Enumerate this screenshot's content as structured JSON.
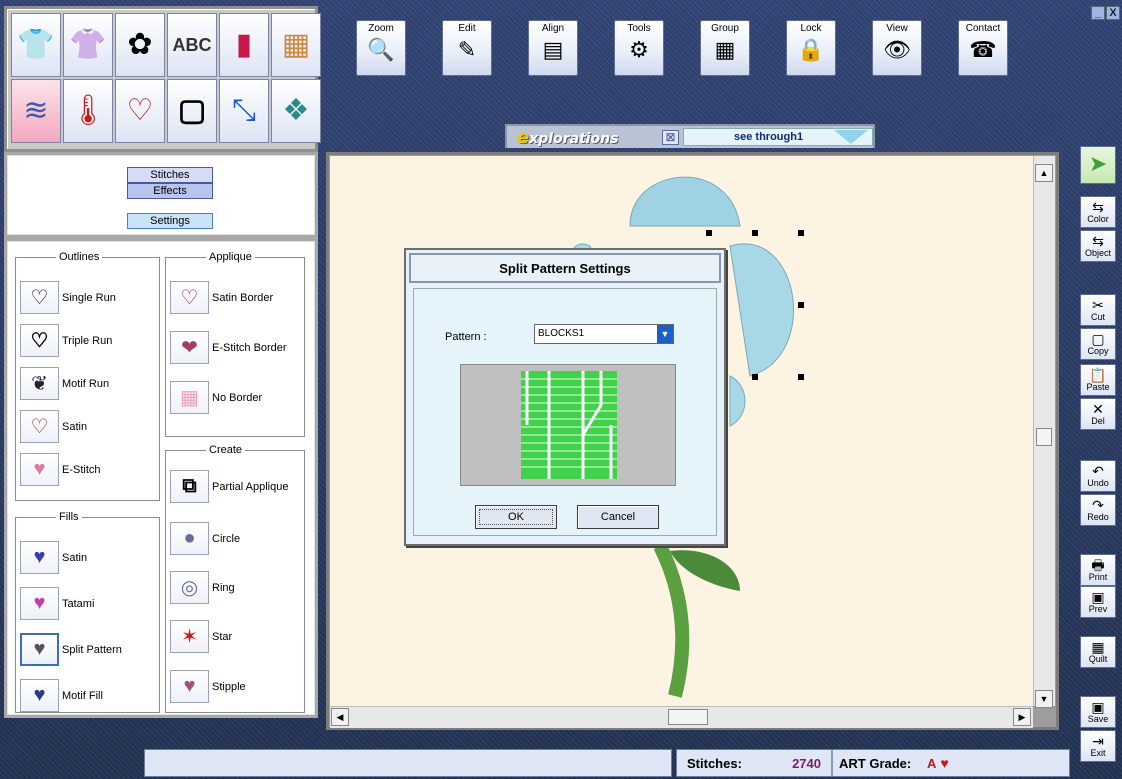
{
  "toolbar": [
    {
      "name": "zoom",
      "label": "Zoom",
      "icon": "🔍"
    },
    {
      "name": "edit",
      "label": "Edit",
      "icon": "✎"
    },
    {
      "name": "align",
      "label": "Align",
      "icon": "▤"
    },
    {
      "name": "tools",
      "label": "Tools",
      "icon": "⚙"
    },
    {
      "name": "group",
      "label": "Group",
      "icon": "▦"
    },
    {
      "name": "lock",
      "label": "Lock",
      "icon": "🔒"
    },
    {
      "name": "view",
      "label": "View",
      "icon": "👁"
    },
    {
      "name": "contact",
      "label": "Contact",
      "icon": "☎"
    }
  ],
  "window_controls": {
    "minimize": "_",
    "close": "X"
  },
  "explorations": {
    "logo_e": "e",
    "logo_rest": "xplorations",
    "close": "⊠",
    "design_name": "see through1"
  },
  "effects_panel": {
    "stitches": "Stitches",
    "effects": "Effects",
    "settings": "Settings"
  },
  "outlines": {
    "legend": "Outlines",
    "items": [
      "Single Run",
      "Triple Run",
      "Motif Run",
      "Satin",
      "E-Stitch"
    ]
  },
  "applique": {
    "legend": "Applique",
    "items": [
      "Satin Border",
      "E-Stitch Border",
      "No Border"
    ]
  },
  "fills": {
    "legend": "Fills",
    "items": [
      "Satin",
      "Tatami",
      "Split Pattern",
      "Motif Fill"
    ]
  },
  "create": {
    "legend": "Create",
    "items": [
      "Partial Applique",
      "Circle",
      "Ring",
      "Star",
      "Stipple"
    ]
  },
  "dialog": {
    "title": "Split Pattern Settings",
    "pattern_label": "Pattern :",
    "pattern_value": "BLOCKS1",
    "ok": "OK",
    "cancel": "Cancel"
  },
  "right_toolbar": [
    {
      "name": "color",
      "label": "Color",
      "icon": "⇆"
    },
    {
      "name": "object",
      "label": "Object",
      "icon": "⇆"
    },
    {
      "name": "cut",
      "label": "Cut",
      "icon": "✂"
    },
    {
      "name": "copy",
      "label": "Copy",
      "icon": "▢"
    },
    {
      "name": "paste",
      "label": "Paste",
      "icon": "📋"
    },
    {
      "name": "del",
      "label": "Del",
      "icon": "✕"
    },
    {
      "name": "undo",
      "label": "Undo",
      "icon": "↶"
    },
    {
      "name": "redo",
      "label": "Redo",
      "icon": "↷"
    },
    {
      "name": "print",
      "label": "Print",
      "icon": "🖶"
    },
    {
      "name": "prev",
      "label": "Prev",
      "icon": "▣"
    },
    {
      "name": "quilt",
      "label": "Quilt",
      "icon": "▦"
    },
    {
      "name": "save",
      "label": "Save",
      "icon": "▣"
    },
    {
      "name": "exit",
      "label": "Exit",
      "icon": "⇥"
    }
  ],
  "status": {
    "message": "",
    "stitches_label": "Stitches:",
    "stitches_value": "2740",
    "grade_label": "ART Grade:",
    "grade_value": "A",
    "heart": "♥"
  },
  "colors": {
    "accent_blue": "#4a5aa0",
    "stitch_count": "#7a1a6a",
    "grade_red": "#c01818",
    "canvas_bg": "#fdf3e2"
  }
}
